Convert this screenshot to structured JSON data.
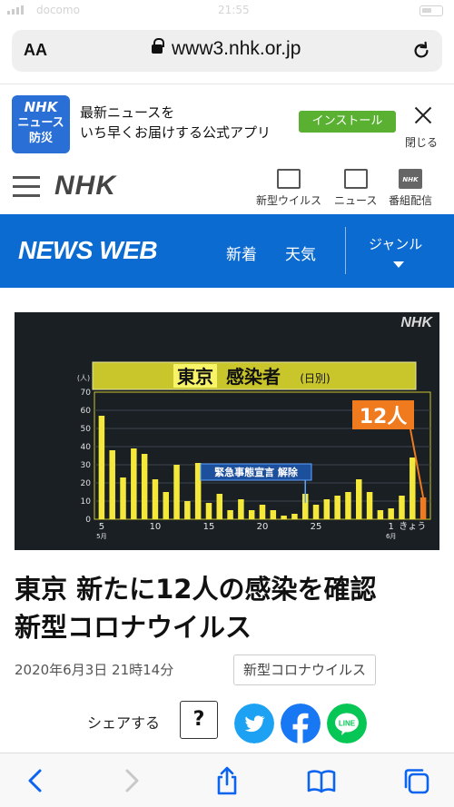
{
  "status_bar": {
    "carrier": "docomo",
    "time": "21:55",
    "battery": ""
  },
  "url_bar": {
    "text_size_label": "AA",
    "url": "www3.nhk.or.jp"
  },
  "app_banner": {
    "logo_top": "NHK",
    "logo_line1": "ニュース",
    "logo_line2": "防災",
    "message_line1": "最新ニュースを",
    "message_line2": "いち早くお届けする公式アプリ",
    "install_label": "インストール",
    "close_label": "閉じる"
  },
  "nhk_nav": {
    "brand": "NHK",
    "items": [
      {
        "label": "新型ウイルス",
        "icon": "virus-info-icon"
      },
      {
        "label": "ニュース",
        "icon": "news-icon"
      },
      {
        "label": "番組配信",
        "icon": "nhk-plus-icon"
      }
    ]
  },
  "news_web_bar": {
    "title": "NEWS WEB",
    "links": [
      "新着",
      "天気"
    ],
    "genre_label": "ジャンル"
  },
  "chart_data": {
    "type": "bar",
    "title": "東京 感染者",
    "title_highlight": "東京",
    "title_rest": "感染者",
    "subtitle": "(日別)",
    "ylabel": "(人)",
    "ylim": [
      0,
      70
    ],
    "yticks": [
      0,
      10,
      20,
      30,
      40,
      50,
      60,
      70
    ],
    "x_tick_labels": [
      {
        "index": 0,
        "label": "5",
        "sub": "5月"
      },
      {
        "index": 5,
        "label": "10"
      },
      {
        "index": 10,
        "label": "15"
      },
      {
        "index": 15,
        "label": "20"
      },
      {
        "index": 20,
        "label": "25"
      },
      {
        "index": 27,
        "label": "1",
        "sub": "6月"
      },
      {
        "index": 29,
        "label": "きょう"
      }
    ],
    "values": [
      57,
      38,
      23,
      39,
      36,
      22,
      15,
      30,
      10,
      31,
      9,
      14,
      5,
      11,
      5,
      8,
      5,
      2,
      3,
      14,
      8,
      11,
      13,
      15,
      22,
      15,
      5,
      6,
      13,
      34,
      12
    ],
    "highlight_last": true,
    "annotation": "緊急事態宣言 解除",
    "callout": "12人",
    "watermark": "NHK",
    "bar_color": "#f4e83a",
    "highlight_color": "#f07a1e",
    "background": "#1a1f24"
  },
  "article": {
    "headline_line1": "東京 新たに12人の感染を確認",
    "headline_line2": "新型コロナウイルス",
    "date": "2020年6月3日 21時14分",
    "tag": "新型コロナウイルス",
    "share_label": "シェアする",
    "help_label": "?"
  },
  "colors": {
    "nhk_blue": "#0c6bd1",
    "install_green": "#5ab031",
    "twitter": "#1da1f2",
    "facebook": "#1877f2",
    "line": "#06c755"
  }
}
